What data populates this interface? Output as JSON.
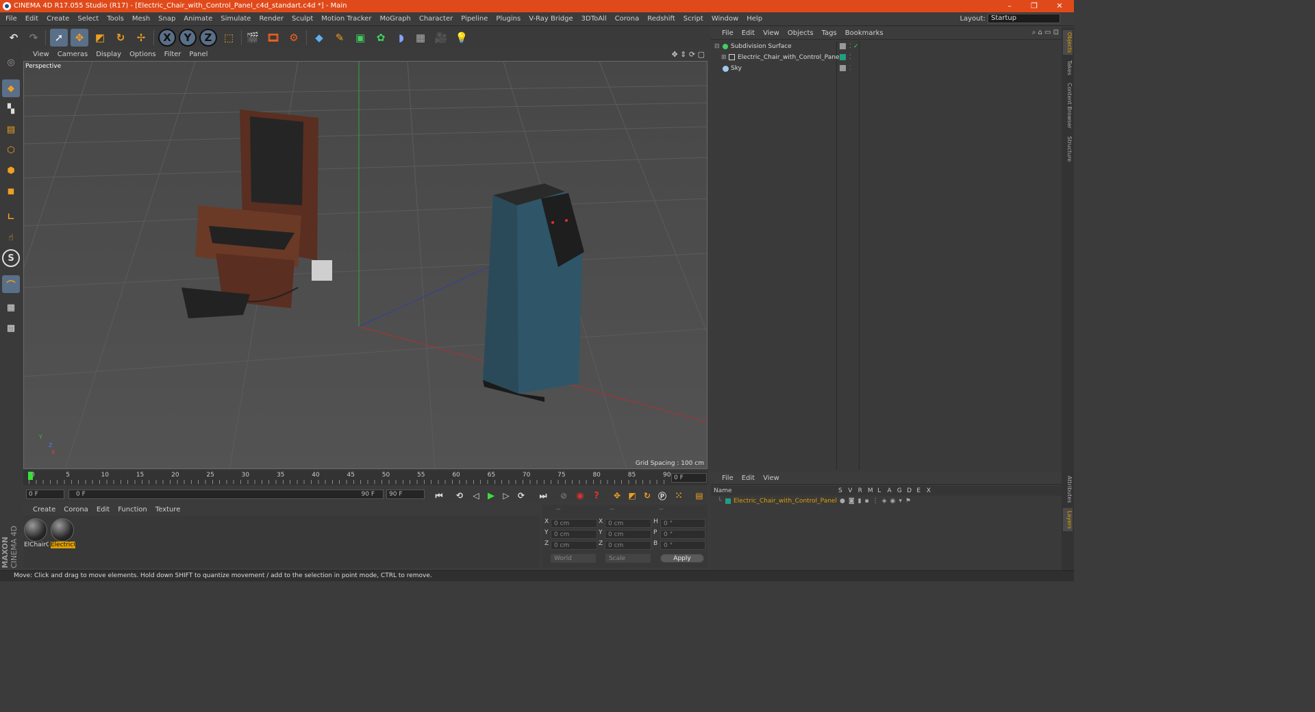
{
  "window": {
    "title": "CINEMA 4D R17.055 Studio (R17) - [Electric_Chair_with_Control_Panel_c4d_standart.c4d *] - Main",
    "minimize": "–",
    "restore": "❐",
    "close": "✕"
  },
  "menubar": {
    "items": [
      "File",
      "Edit",
      "Create",
      "Select",
      "Tools",
      "Mesh",
      "Snap",
      "Animate",
      "Simulate",
      "Render",
      "Sculpt",
      "Motion Tracker",
      "MoGraph",
      "Character",
      "Pipeline",
      "Plugins",
      "V-Ray Bridge",
      "3DToAll",
      "Corona",
      "Redshift",
      "Script",
      "Window",
      "Help"
    ],
    "layout_label": "Layout:",
    "layout_value": "Startup"
  },
  "toolbar": {
    "x_label": "X",
    "y_label": "Y",
    "z_label": "Z"
  },
  "viewport": {
    "menu": [
      "View",
      "Cameras",
      "Display",
      "Options",
      "Filter",
      "Panel"
    ],
    "label": "Perspective",
    "grid_spacing": "Grid Spacing : 100 cm",
    "axis_y": "Y",
    "axis_z": "Z",
    "axis_x": "X"
  },
  "timeline": {
    "ticks": [
      "0",
      "5",
      "10",
      "15",
      "20",
      "25",
      "30",
      "35",
      "40",
      "45",
      "50",
      "55",
      "60",
      "65",
      "70",
      "75",
      "80",
      "85",
      "90"
    ],
    "current_frame": "0 F",
    "start_frame": "0 F",
    "range_start": "0 F",
    "range_end": "90 F",
    "end_frame": "90 F"
  },
  "material_manager": {
    "menu": [
      "Create",
      "Corona",
      "Edit",
      "Function",
      "Texture"
    ],
    "materials": [
      {
        "name": "ElChairC"
      },
      {
        "name": "ElectricC"
      }
    ],
    "brand_top": "MAXON",
    "brand_bottom": "CINEMA 4D"
  },
  "coordinates": {
    "header": [
      "--",
      "--",
      "--"
    ],
    "rows": [
      {
        "a": "X",
        "av": "0 cm",
        "b": "X",
        "bv": "0 cm",
        "c": "H",
        "cv": "0 °"
      },
      {
        "a": "Y",
        "av": "0 cm",
        "b": "Y",
        "bv": "0 cm",
        "c": "P",
        "cv": "0 °"
      },
      {
        "a": "Z",
        "av": "0 cm",
        "b": "Z",
        "bv": "0 cm",
        "c": "B",
        "cv": "0 °"
      }
    ],
    "space": "World",
    "mode": "Scale",
    "apply": "Apply"
  },
  "object_manager": {
    "menu": [
      "File",
      "Edit",
      "View",
      "Objects",
      "Tags",
      "Bookmarks"
    ],
    "objects": [
      {
        "name": "Subdivision Surface"
      },
      {
        "name": "Electric_Chair_with_Control_Panel"
      },
      {
        "name": "Sky"
      }
    ]
  },
  "layer_manager": {
    "menu": [
      "File",
      "Edit",
      "View"
    ],
    "header_name": "Name",
    "columns": [
      "S",
      "V",
      "R",
      "M",
      "L",
      "A",
      "G",
      "D",
      "E",
      "X"
    ],
    "layers": [
      {
        "name": "Electric_Chair_with_Control_Panel"
      }
    ]
  },
  "right_tabs": [
    "Objects",
    "Takes",
    "Content Browser",
    "Structure"
  ],
  "right_tabs_bottom": [
    "Attributes",
    "Layers"
  ],
  "status": "Move: Click and drag to move elements. Hold down SHIFT to quantize movement / add to the selection in point mode, CTRL to remove.",
  "colors": {
    "title_bar": "#e04a1a",
    "accent_orange": "#e0a000",
    "tool_active": "#6a8fb8"
  }
}
